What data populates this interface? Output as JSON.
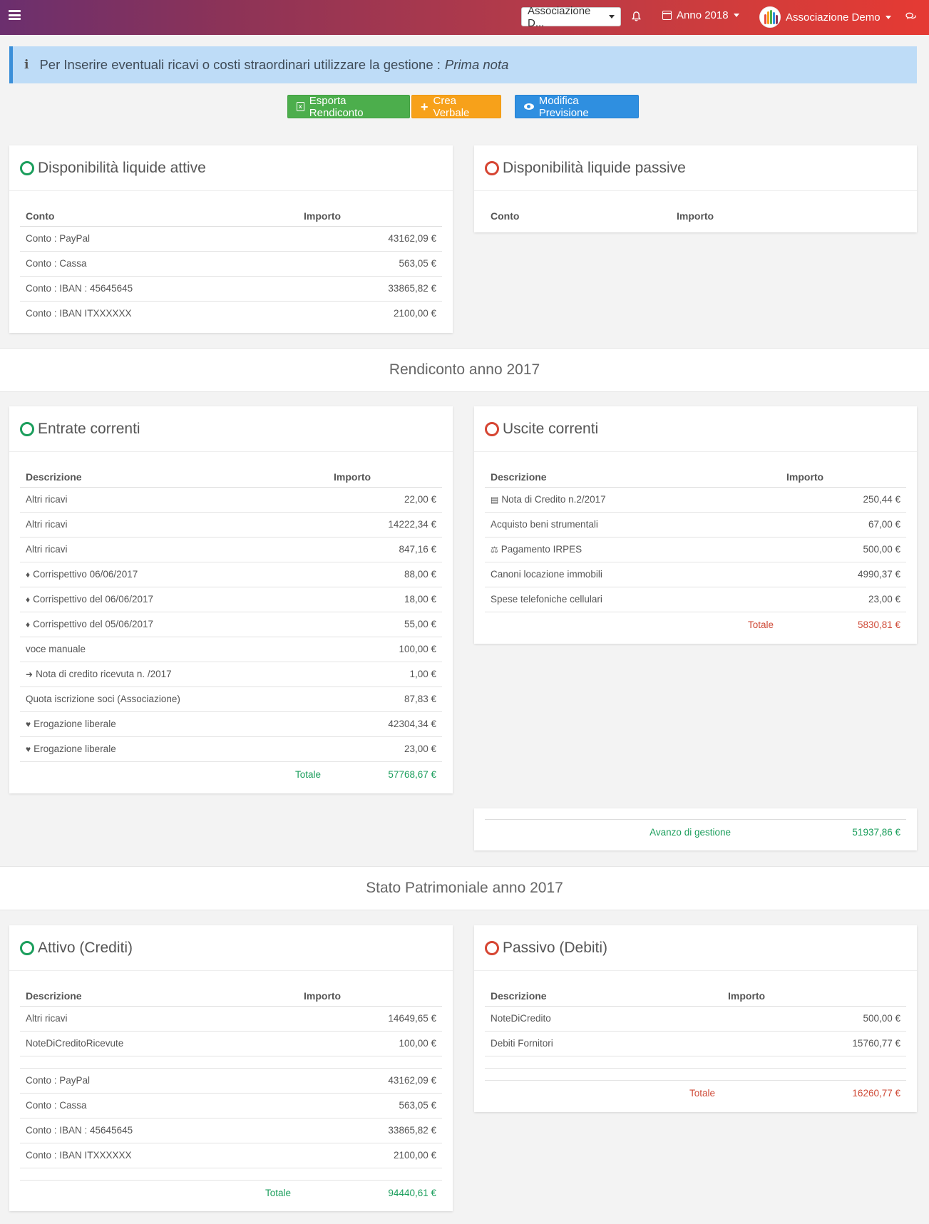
{
  "topbar": {
    "association_select": "Associazione D...",
    "year_label": "Anno 2018",
    "user_name": "Associazione Demo"
  },
  "alert": {
    "text": "Per Inserire eventuali ricavi o costi straordinari utilizzare la gestione :",
    "link": "Prima nota"
  },
  "actions": {
    "export": "Esporta Rendiconto",
    "verbale": "Crea Verbale",
    "previsione": "Modifica Previsione"
  },
  "liquid_active": {
    "title": "Disponibilità liquide attive",
    "col_account": "Conto",
    "col_amount": "Importo",
    "rows": [
      {
        "label": "Conto : PayPal",
        "amount": "43162,09 €"
      },
      {
        "label": "Conto : Cassa",
        "amount": "563,05 €"
      },
      {
        "label": "Conto : IBAN : 45645645",
        "amount": "33865,82 €"
      },
      {
        "label": "Conto : IBAN ITXXXXXX",
        "amount": "2100,00 €"
      }
    ]
  },
  "liquid_passive": {
    "title": "Disponibilità liquide passive",
    "col_account": "Conto",
    "col_amount": "Importo"
  },
  "rendiconto_title": "Rendiconto anno 2017",
  "income": {
    "title": "Entrate correnti",
    "col_desc": "Descrizione",
    "col_amount": "Importo",
    "rows": [
      {
        "icon": "",
        "label": "Altri ricavi",
        "amount": "22,00 €"
      },
      {
        "icon": "",
        "label": "Altri ricavi",
        "amount": "14222,34 €"
      },
      {
        "icon": "",
        "label": "Altri ricavi",
        "amount": "847,16 €"
      },
      {
        "icon": "ticket",
        "label": "Corrispettivo 06/06/2017",
        "amount": "88,00 €"
      },
      {
        "icon": "ticket",
        "label": "Corrispettivo del 06/06/2017",
        "amount": "18,00 €"
      },
      {
        "icon": "ticket",
        "label": "Corrispettivo del 05/06/2017",
        "amount": "55,00 €"
      },
      {
        "icon": "",
        "label": "voce manuale",
        "amount": "100,00 €"
      },
      {
        "icon": "sign-in",
        "label": "Nota di credito ricevuta n. /2017",
        "amount": "1,00 €"
      },
      {
        "icon": "",
        "label": "Quota iscrizione soci (Associazione)",
        "amount": "87,83 €"
      },
      {
        "icon": "heart",
        "label": "Erogazione liberale",
        "amount": "42304,34 €"
      },
      {
        "icon": "heart",
        "label": "Erogazione liberale",
        "amount": "23,00 €"
      }
    ],
    "total_label": "Totale",
    "total": "57768,67 €"
  },
  "expenses": {
    "title": "Uscite correnti",
    "col_desc": "Descrizione",
    "col_amount": "Importo",
    "rows": [
      {
        "icon": "file",
        "label": "Nota di Credito n.2/2017",
        "amount": "250,44 €"
      },
      {
        "icon": "",
        "label": "Acquisto beni strumentali",
        "amount": "67,00 €"
      },
      {
        "icon": "balance",
        "label": "Pagamento IRPES",
        "amount": "500,00 €"
      },
      {
        "icon": "",
        "label": "Canoni locazione immobili",
        "amount": "4990,37 €"
      },
      {
        "icon": "",
        "label": "Spese telefoniche cellulari",
        "amount": "23,00 €"
      }
    ],
    "total_label": "Totale",
    "total": "5830,81 €"
  },
  "surplus": {
    "label": "Avanzo di gestione",
    "amount": "51937,86 €"
  },
  "patrimonio_title": "Stato Patrimoniale anno 2017",
  "assets": {
    "title": "Attivo (Crediti)",
    "col_desc": "Descrizione",
    "col_amount": "Importo",
    "rows": [
      {
        "label": "Altri ricavi",
        "amount": "14649,65 €"
      },
      {
        "label": "NoteDiCreditoRicevute",
        "amount": "100,00 €"
      }
    ],
    "accounts": [
      {
        "label": "Conto : PayPal",
        "amount": "43162,09 €"
      },
      {
        "label": "Conto : Cassa",
        "amount": "563,05 €"
      },
      {
        "label": "Conto : IBAN : 45645645",
        "amount": "33865,82 €"
      },
      {
        "label": "Conto : IBAN ITXXXXXX",
        "amount": "2100,00 €"
      }
    ],
    "total_label": "Totale",
    "total": "94440,61 €"
  },
  "liabilities": {
    "title": "Passivo (Debiti)",
    "col_desc": "Descrizione",
    "col_amount": "Importo",
    "rows": [
      {
        "label": "NoteDiCredito",
        "amount": "500,00 €"
      },
      {
        "label": "Debiti Fornitori",
        "amount": "15760,77 €"
      }
    ],
    "total_label": "Totale",
    "total": "16260,77 €"
  }
}
